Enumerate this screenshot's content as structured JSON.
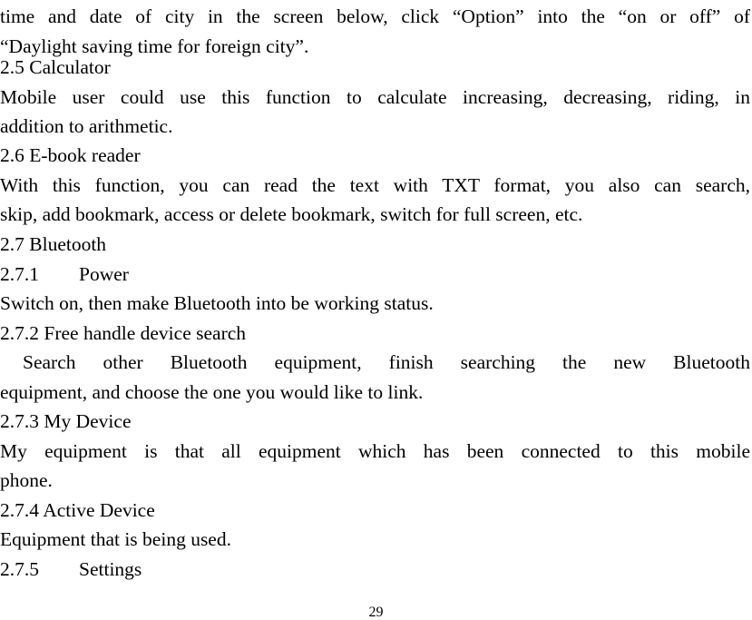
{
  "page": {
    "page_number": "29",
    "intro": {
      "line1": "time and date of city in the screen below, click “Option” into the “on or off” of",
      "line2": "“Daylight saving time for foreign city”."
    },
    "sections": {
      "calculator": {
        "heading": "2.5 Calculator",
        "body_line1": "Mobile user could use this function to calculate increasing, decreasing, riding, in",
        "body_line2": "addition to arithmetic."
      },
      "ebook": {
        "heading": "2.6 E-book reader",
        "body_line1": "With this function, you can read the text with TXT format, you also can search,",
        "body_line2": "skip, add bookmark, access or delete bookmark, switch for full screen, etc."
      },
      "bluetooth": {
        "heading": "2.7 Bluetooth",
        "power": {
          "number": "2.7.1",
          "title": "Power",
          "body": "Switch on, then make Bluetooth into be working status."
        },
        "search": {
          "heading": "2.7.2 Free handle device search",
          "body_line1": "Search other Bluetooth equipment, finish searching the new Bluetooth",
          "body_line2": "equipment, and choose the one you would like to link."
        },
        "my_device": {
          "heading": "2.7.3 My Device",
          "body_line1": "My equipment is that all equipment which has been connected to this mobile",
          "body_line2": "phone."
        },
        "active_device": {
          "heading": "2.7.4 Active Device",
          "body": "Equipment that is being used."
        },
        "settings": {
          "number": "2.7.5",
          "title": "Settings"
        }
      }
    }
  }
}
